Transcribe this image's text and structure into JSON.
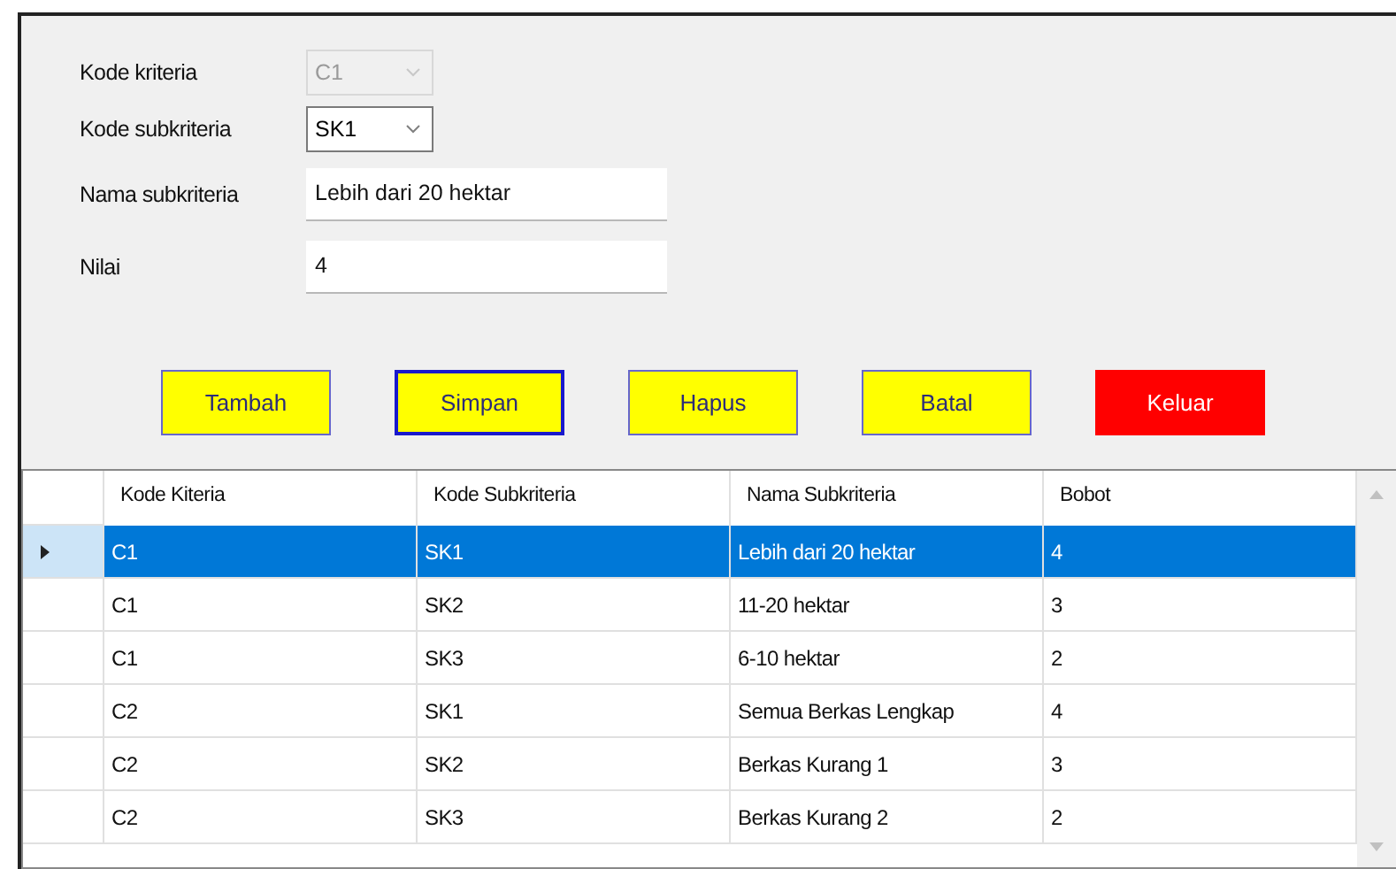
{
  "form": {
    "fields": [
      {
        "kind": "combo",
        "label": "Kode kriteria",
        "value": "C1",
        "disabled": true
      },
      {
        "kind": "combo",
        "label": "Kode subkriteria",
        "value": "SK1",
        "disabled": false
      },
      {
        "kind": "text",
        "label": "Nama subkriteria",
        "value": "Lebih dari 20 hektar"
      },
      {
        "kind": "text",
        "label": "Nilai",
        "value": "4"
      }
    ],
    "buttons": [
      {
        "label": "Tambah",
        "color": "#ffff00",
        "focused": false
      },
      {
        "label": "Simpan",
        "color": "#ffff00",
        "focused": true
      },
      {
        "label": "Hapus",
        "color": "#ffff00",
        "focused": false
      },
      {
        "label": "Batal",
        "color": "#ffff00",
        "focused": false
      },
      {
        "label": "Keluar",
        "color": "#ff0000",
        "focused": false
      }
    ]
  },
  "table": {
    "columns": [
      "Kode Kiteria",
      "Kode Subkriteria",
      "Nama Subkriteria",
      "Bobot"
    ],
    "rows": [
      {
        "cells": [
          "C1",
          "SK1",
          "Lebih dari 20 hektar",
          "4"
        ],
        "selected": true
      },
      {
        "cells": [
          "C1",
          "SK2",
          "11-20 hektar",
          "3"
        ],
        "selected": false
      },
      {
        "cells": [
          "C1",
          "SK3",
          "6-10 hektar",
          "2"
        ],
        "selected": false
      },
      {
        "cells": [
          "C2",
          "SK1",
          "Semua Berkas Lengkap",
          "4"
        ],
        "selected": false
      },
      {
        "cells": [
          "C2",
          "SK2",
          "Berkas Kurang 1",
          "3"
        ],
        "selected": false
      },
      {
        "cells": [
          "C2",
          "SK3",
          "Berkas Kurang 2",
          "2"
        ],
        "selected": false
      }
    ]
  }
}
